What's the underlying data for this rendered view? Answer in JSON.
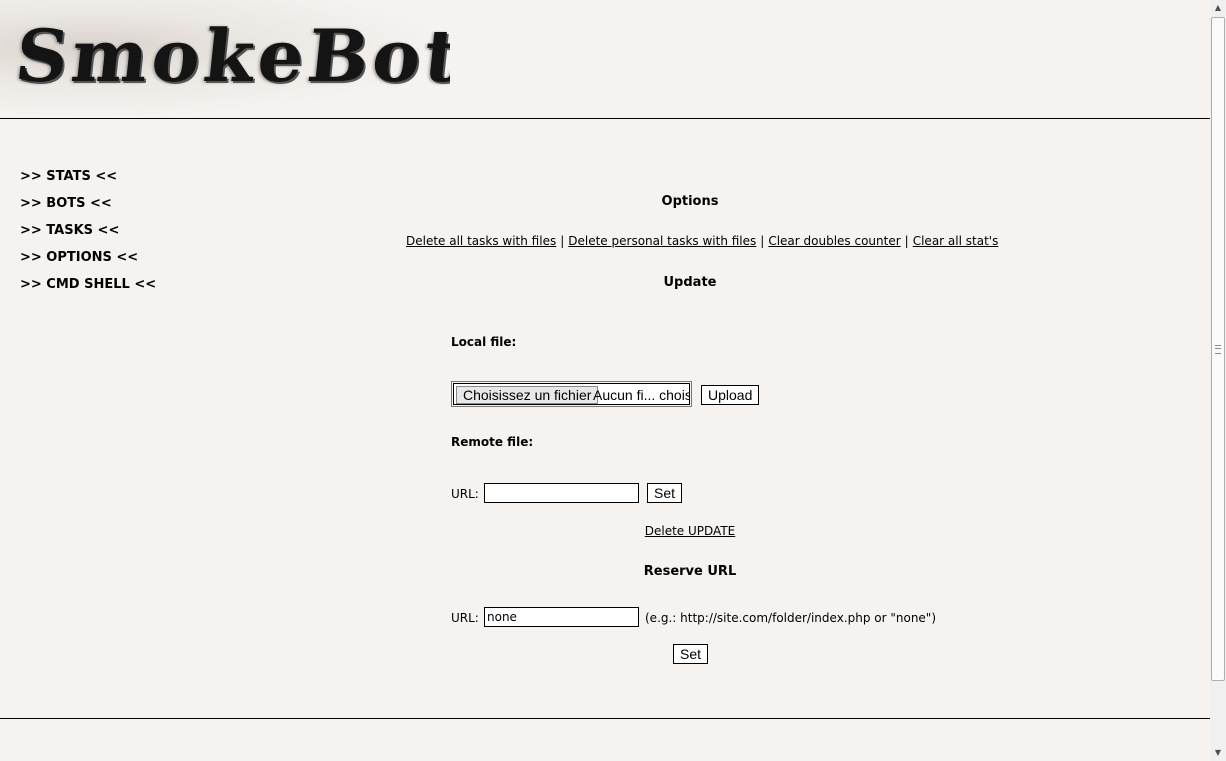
{
  "header": {
    "logo_text": "SmokeBot"
  },
  "menu": {
    "items": [
      {
        "label": ">> STATS <<"
      },
      {
        "label": ">> BOTS <<"
      },
      {
        "label": ">> TASKS <<"
      },
      {
        "label": ">> OPTIONS <<"
      },
      {
        "label": ">> CMD SHELL <<"
      }
    ]
  },
  "options": {
    "title": "Options",
    "links": [
      "Delete all tasks with files",
      "Delete personal tasks with files",
      "Clear doubles counter",
      "Clear all stat's"
    ],
    "separator": "|"
  },
  "update": {
    "title": "Update",
    "local_file_label": "Local file:",
    "file_button_label": "Choisissez un fichier",
    "file_status": "Aucun fi... choisi",
    "upload_label": "Upload",
    "remote_file_label": "Remote file:",
    "url_label": "URL:",
    "url_value": "",
    "set_label": "Set",
    "delete_update_label": "Delete UPDATE"
  },
  "reserve": {
    "title": "Reserve URL",
    "url_label": "URL:",
    "url_value": "none",
    "hint": "(e.g.: http://site.com/folder/index.php or \"none\")",
    "set_label": "Set"
  }
}
